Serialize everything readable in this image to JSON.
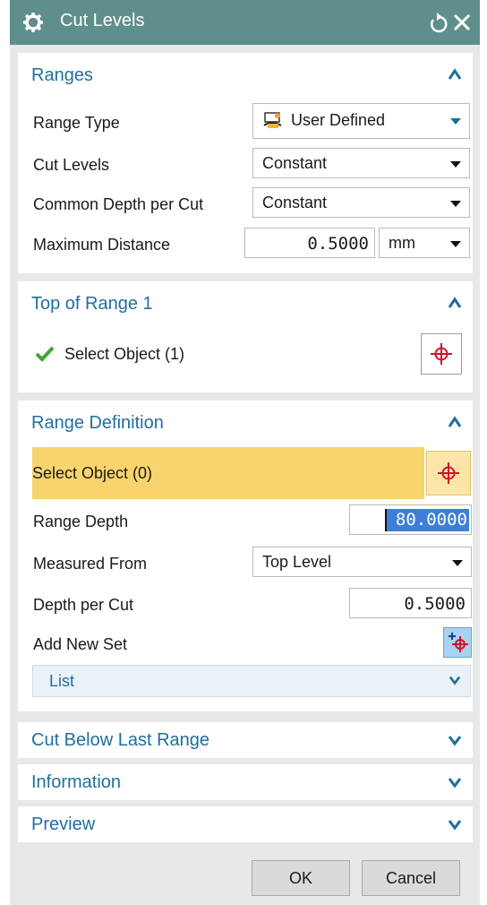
{
  "window": {
    "title": "Cut Levels",
    "gear_icon": "gear-icon",
    "reset_icon": "reset-icon",
    "close_icon": "close-icon"
  },
  "ranges": {
    "title": "Ranges",
    "range_type_label": "Range Type",
    "range_type_value": "User Defined",
    "cut_levels_label": "Cut Levels",
    "cut_levels_value": "Constant",
    "common_depth_label": "Common Depth per Cut",
    "common_depth_value": "Constant",
    "max_distance_label": "Maximum Distance",
    "max_distance_value": "0.5000",
    "max_distance_unit": "mm"
  },
  "top_of_range": {
    "title": "Top of Range 1",
    "select_label": "Select Object (1)"
  },
  "range_definition": {
    "title": "Range Definition",
    "select_label": "Select Object (0)",
    "range_depth_label": "Range Depth",
    "range_depth_value": "80.0000",
    "measured_from_label": "Measured From",
    "measured_from_value": "Top Level",
    "depth_per_cut_label": "Depth per Cut",
    "depth_per_cut_value": "0.5000",
    "add_new_set_label": "Add New Set",
    "list_label": "List"
  },
  "collapsed_sections": {
    "cut_below": "Cut Below Last Range",
    "information": "Information",
    "preview": "Preview"
  },
  "footer": {
    "ok": "OK",
    "cancel": "Cancel"
  },
  "colors": {
    "titlebar": "#5f8f8c",
    "section_title": "#1f6f9e",
    "highlight": "#f9d46c",
    "selection": "#3d7fd6"
  }
}
